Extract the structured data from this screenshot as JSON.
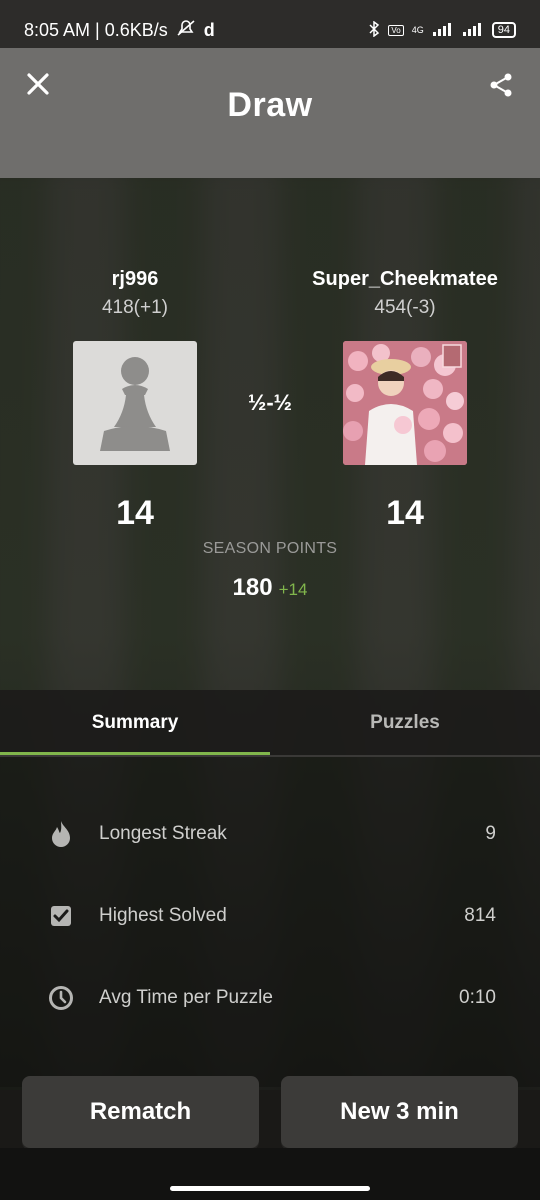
{
  "status_bar": {
    "time_speed": "8:05 AM | 0.6KB/s",
    "extra": "d",
    "network": "4G",
    "battery": "94"
  },
  "header": {
    "title": "Draw"
  },
  "players": [
    {
      "name": "rj996",
      "rating": "418(+1)",
      "score": "14"
    },
    {
      "name": "Super_Cheekmatee",
      "rating": "454(-3)",
      "score": "14"
    }
  ],
  "result": "½-½",
  "season": {
    "label": "SEASON POINTS",
    "value": "180",
    "delta": "+14"
  },
  "tabs": [
    {
      "label": "Summary"
    },
    {
      "label": "Puzzles"
    }
  ],
  "stats": [
    {
      "icon": "flame-icon",
      "label": "Longest Streak",
      "value": "9"
    },
    {
      "icon": "checkbox-icon",
      "label": "Highest Solved",
      "value": "814"
    },
    {
      "icon": "clock-icon",
      "label": "Avg Time per Puzzle",
      "value": "0:10"
    }
  ],
  "buttons": {
    "rematch": "Rematch",
    "new_game": "New 3 min"
  },
  "colors": {
    "accent": "#81b64c",
    "header": "#6f6e6c",
    "button": "#3c3b39"
  }
}
